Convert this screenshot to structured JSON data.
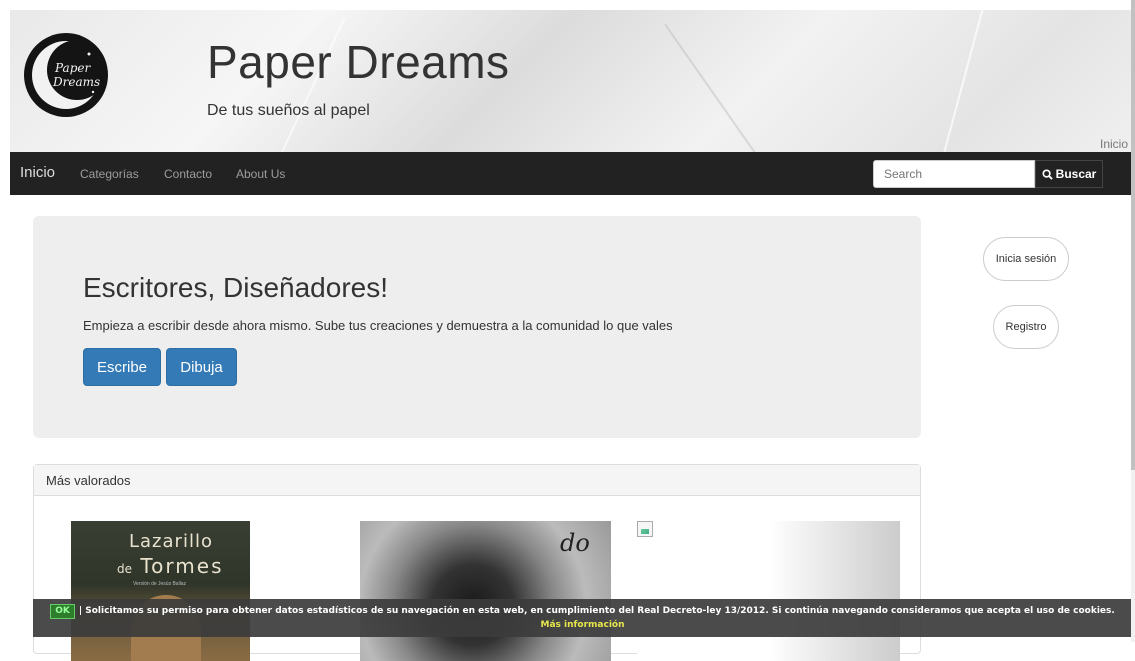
{
  "header": {
    "logo_text": "Paper Dreams",
    "title": "Paper Dreams",
    "tagline": "De tus sueños al papel",
    "breadcrumb": "Inicio"
  },
  "nav": {
    "brand": "Inicio",
    "links": [
      "Categorías",
      "Contacto",
      "About Us"
    ],
    "search_placeholder": "Search",
    "search_button": "Buscar"
  },
  "jumbotron": {
    "heading": "Escritores, Diseñadores!",
    "text": "Empieza a escribir desde ahora mismo. Sube tus creaciones y demuestra a la comunidad lo que vales",
    "btn_write": "Escribe",
    "btn_draw": "Dibuja"
  },
  "side": {
    "login": "Inicia sesión",
    "register": "Registro"
  },
  "panel": {
    "heading": "Más valorados",
    "books": [
      {
        "line1": "Lazarillo",
        "prefix": "de",
        "line2": "Tormes",
        "subtitle": "Versión de Jesús Ballaz"
      },
      {
        "text": "do"
      },
      {
        "broken": true
      }
    ]
  },
  "cookie": {
    "ok": "OK",
    "message": "| Solicitamos su permiso para obtener datos estadísticos de su navegación en esta web, en cumplimiento del Real Decreto-ley 13/2012. Si continúa navegando consideramos que acepta el uso de cookies.",
    "more": "Más información"
  },
  "colors": {
    "navbar": "#222222",
    "primary": "#337ab7",
    "jumbotron": "#eeeeee"
  }
}
